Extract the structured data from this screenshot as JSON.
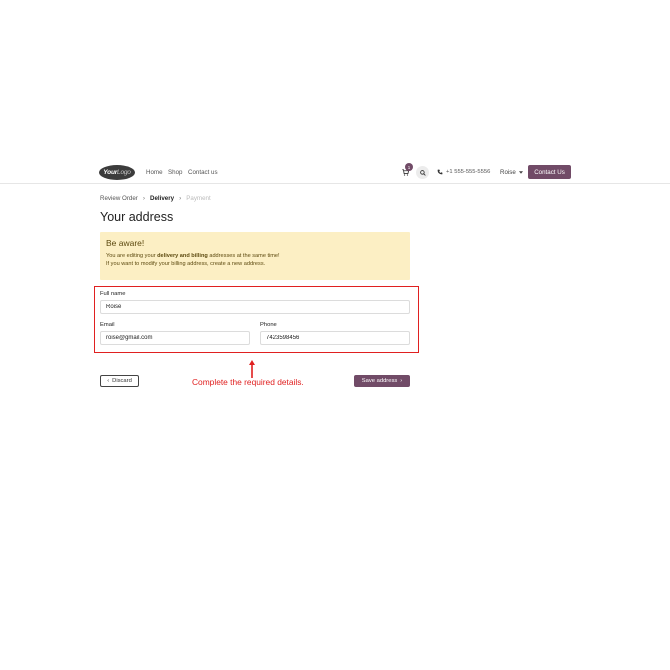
{
  "header": {
    "logo_text_bold": "Your",
    "logo_text_light": "Logo",
    "nav_links": [
      "Home",
      "Shop",
      "Contact us"
    ],
    "cart_count": "1",
    "phone": "+1 555-555-5556",
    "user_name": "Roise",
    "contact_button": "Contact Us"
  },
  "breadcrumb": {
    "steps": [
      "Review Order",
      "Delivery",
      "Payment"
    ],
    "separator": "›"
  },
  "page": {
    "title": "Your address"
  },
  "alert": {
    "title": "Be aware!",
    "line1_prefix": "You are editing your ",
    "line1_bold": "delivery and billing",
    "line1_suffix": " addresses at the same time!",
    "line2": "If you want to modify your billing address, create a new address."
  },
  "form": {
    "full_name_label": "Full name",
    "full_name_value": "Roise",
    "email_label": "Email",
    "email_value": "roise@gmail.com",
    "phone_label": "Phone",
    "phone_value": "7423598456"
  },
  "annotation": {
    "text": "Complete the required details."
  },
  "actions": {
    "discard_label": "Discard",
    "discard_icon": "‹",
    "save_label": "Save address",
    "save_icon": "›"
  },
  "colors": {
    "brand": "#714b67",
    "alert_bg": "#fcefc4",
    "annotation_red": "#e02020"
  }
}
